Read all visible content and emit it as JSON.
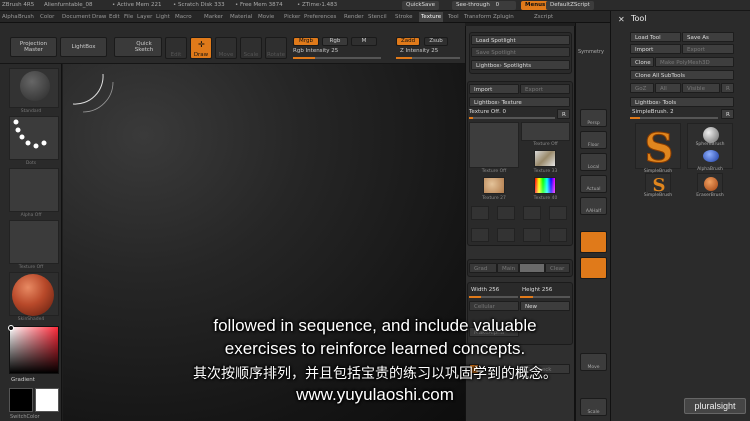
{
  "titlebar": {
    "app": "ZBrush 4R5",
    "file": "Alienfurntable_08",
    "active_mem": "• Active Mem 221",
    "scratch": "• Scratch Disk 333",
    "free_mem": "• Free Mem 3874",
    "ztime": "• ZTime›1.483",
    "quicksave": "QuickSave",
    "seethrough": "See-through",
    "seethrough_val": "0",
    "menus": "Menus",
    "script": "DefaultZScript"
  },
  "menubar": {
    "items": [
      "Alpha",
      "Brush",
      "Color",
      "Document",
      "Draw",
      "Edit",
      "File",
      "Layer",
      "Light",
      "Macro",
      "Marker",
      "Material",
      "Movie",
      "Picker",
      "Preferences",
      "Render",
      "Stencil",
      "Stroke",
      "Texture",
      "Tool",
      "Transform",
      "Zplugin",
      "Zscript"
    ],
    "active": "Texture"
  },
  "toolbar": {
    "projection_master": "Projection Master",
    "lightbox": "LightBox",
    "quick_sketch": "Quick Sketch",
    "edit": "Edit",
    "draw": "Draw",
    "move": "Move",
    "scale": "Scale",
    "rotate": "Rotate",
    "mrgb": "Mrgb",
    "rgb": "Rgb",
    "m": "M",
    "rgb_intensity": "Rgb Intensity 25",
    "rgb_intensity_level": 0.25,
    "zadd": "Zadd",
    "zsub": "Zsub",
    "z_intensity": "Z Intensity 25",
    "z_intensity_level": 0.25
  },
  "leftshelf": {
    "brush": "Standard",
    "stroke": "Dots",
    "alpha": "Alpha Off",
    "texture": "Texture Off",
    "material": "SkinShade4",
    "gradient": "Gradient",
    "switch_color": "SwitchColor"
  },
  "texture_menu": {
    "load_spotlight": "Load Spotlight",
    "save_spotlight": "Save Spotlight",
    "lightbox_spotlights": "Lightbox› Spotlights",
    "import": "Import",
    "export": "Export",
    "lightbox_texture": "Lightbox› Texture",
    "texture_off": "Texture Off. 0",
    "r": "R",
    "thumbs": [
      "Texture Off",
      "Texture Off",
      "Texture 33",
      "Texture 27",
      "Texture 40"
    ],
    "grad": "Grad",
    "main": "Main",
    "clear": "Clear",
    "width": "Width 256",
    "width_level": 0.25,
    "height": "Height 256",
    "height_level": 0.25,
    "new": "New",
    "cellular": "Cellular",
    "make_alpha": "MakeAlpha",
    "uv_check": "UV Check"
  },
  "rightstrip": {
    "symmetry": "Symmetry",
    "buttons": [
      "Persp",
      "Floor",
      "Local",
      "Actual",
      "AAHalf",
      "Move",
      "Scale"
    ]
  },
  "toolpanel": {
    "title": "Tool",
    "load_tool": "Load Tool",
    "save_as": "Save As",
    "import": "Import",
    "export": "Export",
    "clone": "Clone",
    "make_polymesh": "Make PolyMesh3D",
    "clone_all": "Clone All SubTools",
    "goz": "GoZ",
    "all": "All",
    "visible": "Visible",
    "r": "R",
    "lightbox_tools": "Lightbox› Tools",
    "current_tool": "SimpleBrush. 2",
    "current_tool_r": "R",
    "tools": [
      "SimpleBrush",
      "SphereBrush",
      "AlphaBrush",
      "SimpleBrush",
      "EraserBrush"
    ]
  },
  "subtitles": {
    "line1": "followed in sequence, and include valuable",
    "line2": "exercises to reinforce learned concepts.",
    "line3": "其次按顺序排列，并且包括宝贵的练习以巩固学到的概念。",
    "line4": "www.yuyulaoshi.com"
  },
  "watermark": "pluralsight",
  "colors": {
    "accent": "#e07a1a",
    "primary_color": "#ffffff",
    "secondary_color": "#000000"
  }
}
